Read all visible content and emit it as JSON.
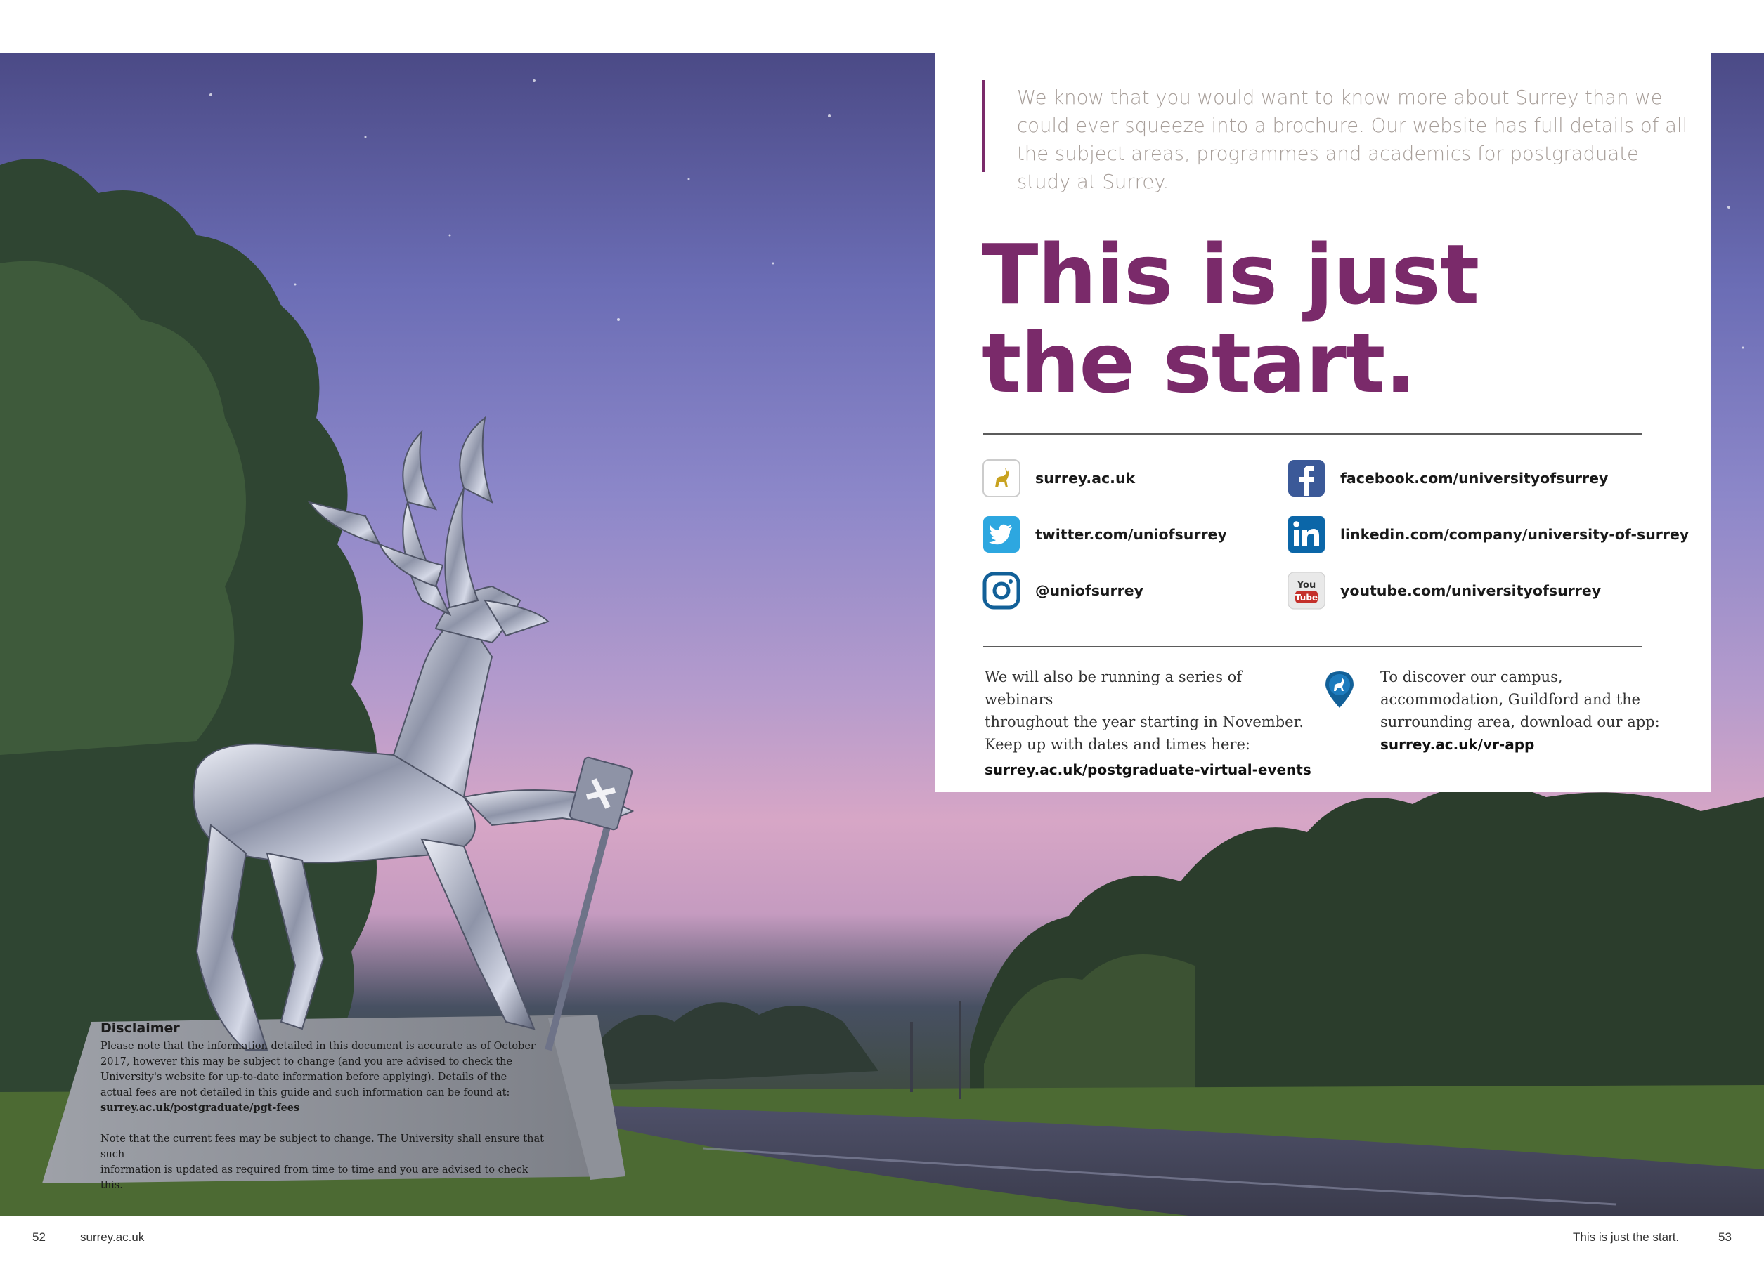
{
  "intro": "We know that you would want to know more about Surrey than we could ever squeeze into a brochure. Our website has full details of all the subject areas, programmes and academics for postgraduate study at Surrey.",
  "headline": {
    "line1": "This is just",
    "line2": "the start."
  },
  "links": [
    {
      "icon": "surrey-stag-icon",
      "text": "surrey.ac.uk"
    },
    {
      "icon": "facebook-icon",
      "text": "facebook.com/universityofsurrey"
    },
    {
      "icon": "twitter-icon",
      "text": "twitter.com/uniofsurrey"
    },
    {
      "icon": "linkedin-icon",
      "text": "linkedin.com/company/university-of-surrey"
    },
    {
      "icon": "instagram-icon",
      "text": "@uniofsurrey"
    },
    {
      "icon": "youtube-icon",
      "text": "youtube.com/universityofsurrey"
    }
  ],
  "webinars": {
    "line1": "We will also be running a series of webinars",
    "line2": "throughout the year starting in November.",
    "line3": "Keep up with dates and times here:",
    "url": "surrey.ac.uk/postgraduate-virtual-events"
  },
  "app": {
    "icon": "map-pin-stag-icon",
    "line1": "To discover our campus,",
    "line2": "accommodation, Guildford and the",
    "line3": "surrounding area, download our app:",
    "url": "surrey.ac.uk/vr-app"
  },
  "disclaimer": {
    "title": "Disclaimer",
    "p1_l1": "Please note that the information detailed in this document is accurate as of October",
    "p1_l2": "2017, however this may be subject to change (and you are advised to check the",
    "p1_l3": "University's website for up-to-date information before applying). Details of the",
    "p1_l4": "actual fees are not detailed in this guide and such information can be found at:",
    "url": "surrey.ac.uk/postgraduate/pgt-fees",
    "p2_l1": "Note that the current fees may be subject to change. The University shall ensure that such",
    "p2_l2": "information is updated as required from time to time and you are advised to check this."
  },
  "footer": {
    "left_page": "52",
    "left_site": "surrey.ac.uk",
    "right_title": "This is just the start.",
    "right_page": "53"
  },
  "colors": {
    "accent_purple": "#7a2a6a",
    "intro_grey": "#a79e99",
    "facebook": "#3b5998",
    "twitter": "#2da7e0",
    "linkedin": "#0b66a8",
    "instagram": "#126098",
    "youtube": "#c4302b",
    "surrey_gold": "#c8a21f"
  }
}
